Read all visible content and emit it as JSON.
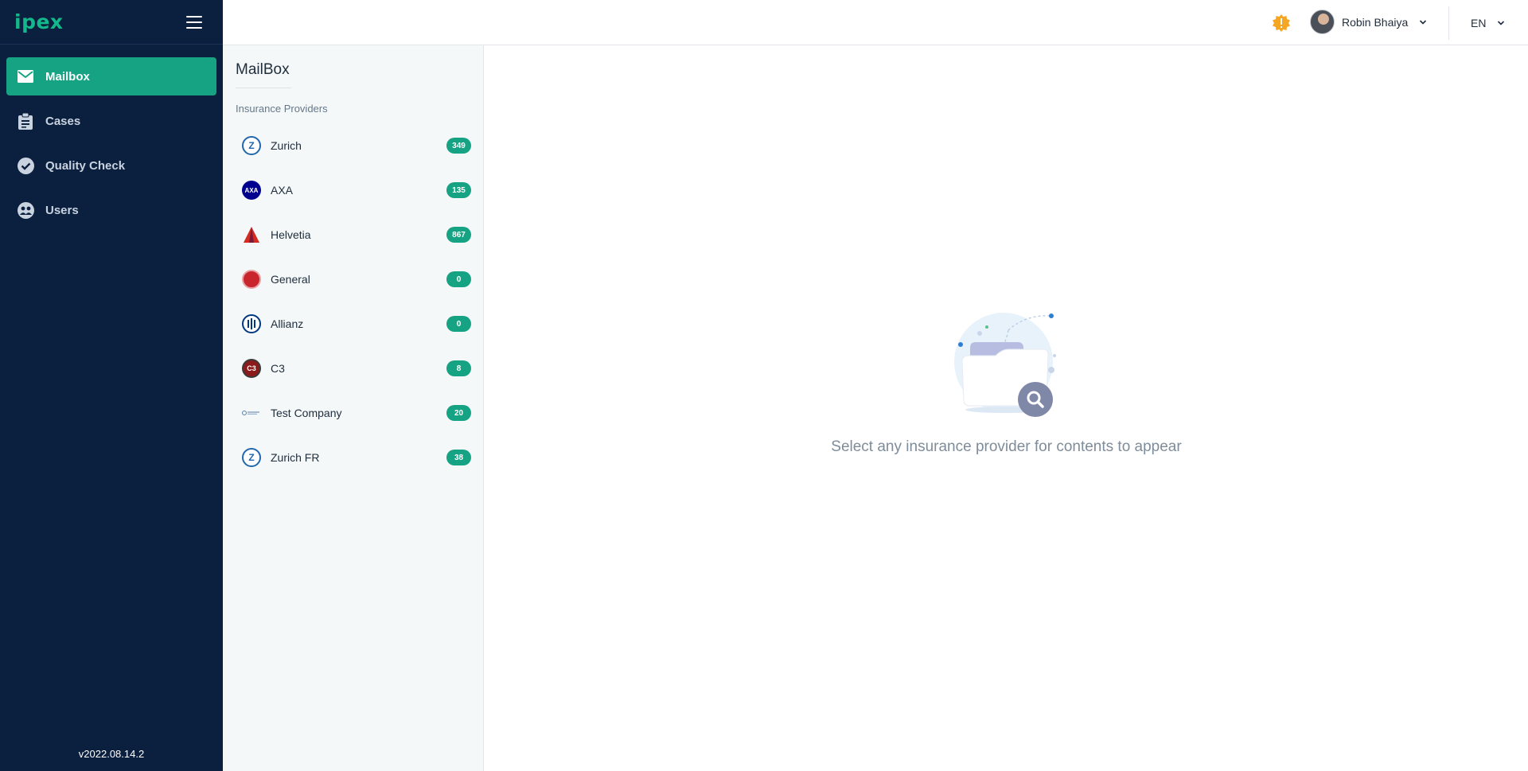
{
  "sidebar": {
    "logo": "ipex",
    "nav": [
      {
        "label": "Mailbox",
        "icon": "mail-icon",
        "active": true
      },
      {
        "label": "Cases",
        "icon": "clipboard-icon",
        "active": false
      },
      {
        "label": "Quality Check",
        "icon": "check-circle-icon",
        "active": false
      },
      {
        "label": "Users",
        "icon": "users-icon",
        "active": false
      }
    ],
    "version": "v2022.08.14.2"
  },
  "header": {
    "user_name": "Robin Bhaiya",
    "language": "EN"
  },
  "mailbox": {
    "title": "MailBox",
    "section_label": "Insurance Providers",
    "providers": [
      {
        "name": "Zurich",
        "count": "349",
        "logo_color": "#2167ae"
      },
      {
        "name": "AXA",
        "count": "135",
        "logo_color": "#00008f"
      },
      {
        "name": "Helvetia",
        "count": "867",
        "logo_color": "#d52b1e"
      },
      {
        "name": "General",
        "count": "0",
        "logo_color": "#c8252c"
      },
      {
        "name": "Allianz",
        "count": "0",
        "logo_color": "#003781"
      },
      {
        "name": "C3",
        "count": "8",
        "logo_color": "#8b1a1a"
      },
      {
        "name": "Test Company",
        "count": "20",
        "logo_color": "#5a7fa8"
      },
      {
        "name": "Zurich FR",
        "count": "38",
        "logo_color": "#2167ae"
      }
    ]
  },
  "main": {
    "empty_message": "Select any insurance provider for contents to appear"
  },
  "colors": {
    "sidebar_bg": "#0b1f3f",
    "accent": "#16a383",
    "alert": "#f5a623"
  }
}
